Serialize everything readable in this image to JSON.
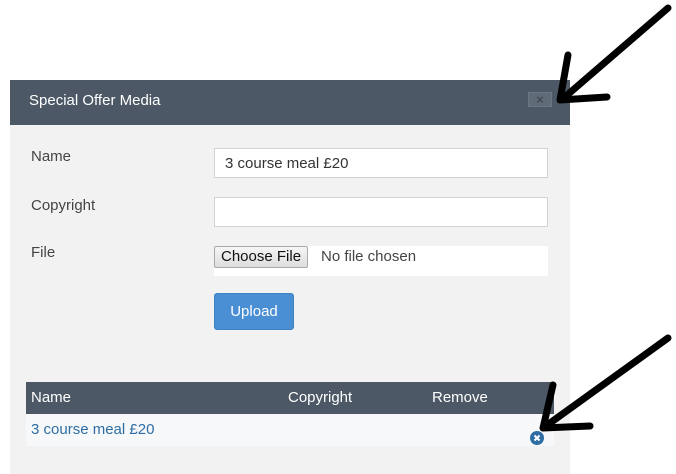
{
  "dialog": {
    "title": "Special Offer Media",
    "close_label": "×"
  },
  "form": {
    "name_label": "Name",
    "name_value": "3 course meal £20",
    "copyright_label": "Copyright",
    "copyright_value": "",
    "file_label": "File",
    "choose_file_label": "Choose File",
    "file_status": "No file chosen",
    "upload_label": "Upload"
  },
  "table": {
    "columns": [
      "Name",
      "Copyright",
      "Remove"
    ],
    "rows": [
      {
        "name": "3 course meal £20",
        "copyright": ""
      }
    ]
  },
  "icons": {
    "close": "close-icon",
    "remove": "remove-circle-icon",
    "annotation": "arrow-icon"
  },
  "colors": {
    "header_bg": "#4c5866",
    "dialog_bg": "#f2f2f2",
    "upload_button": "#4a8fd4",
    "link": "#2e6da4"
  }
}
